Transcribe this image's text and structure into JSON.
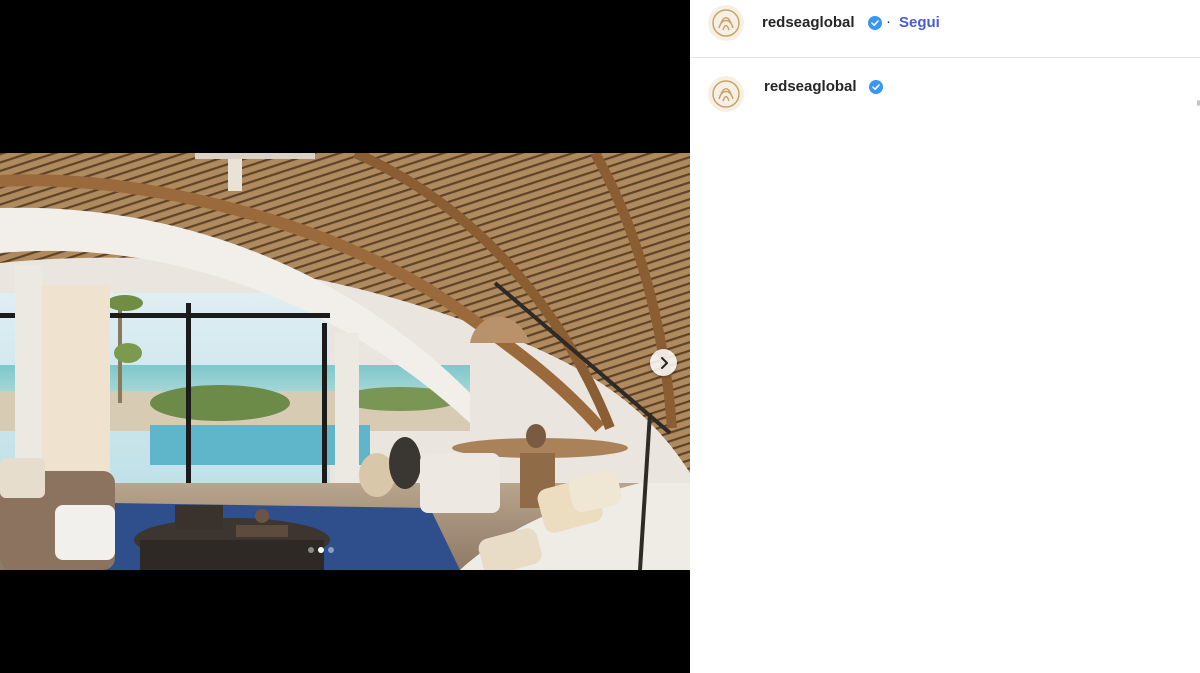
{
  "post": {
    "username": "redseaglobal",
    "separator": "·",
    "follow_label": "Segui",
    "carousel": {
      "current_index": 1,
      "total": 3
    }
  },
  "caption": {
    "username": "redseaglobal"
  },
  "colors": {
    "accent": "#4a5bd4",
    "verified": "#3897f0",
    "text": "#262626",
    "media_bg": "#000000"
  },
  "icons": {
    "next": "chevron-right-icon",
    "verified": "verified-badge-icon",
    "avatar": "brand-logo-icon"
  }
}
